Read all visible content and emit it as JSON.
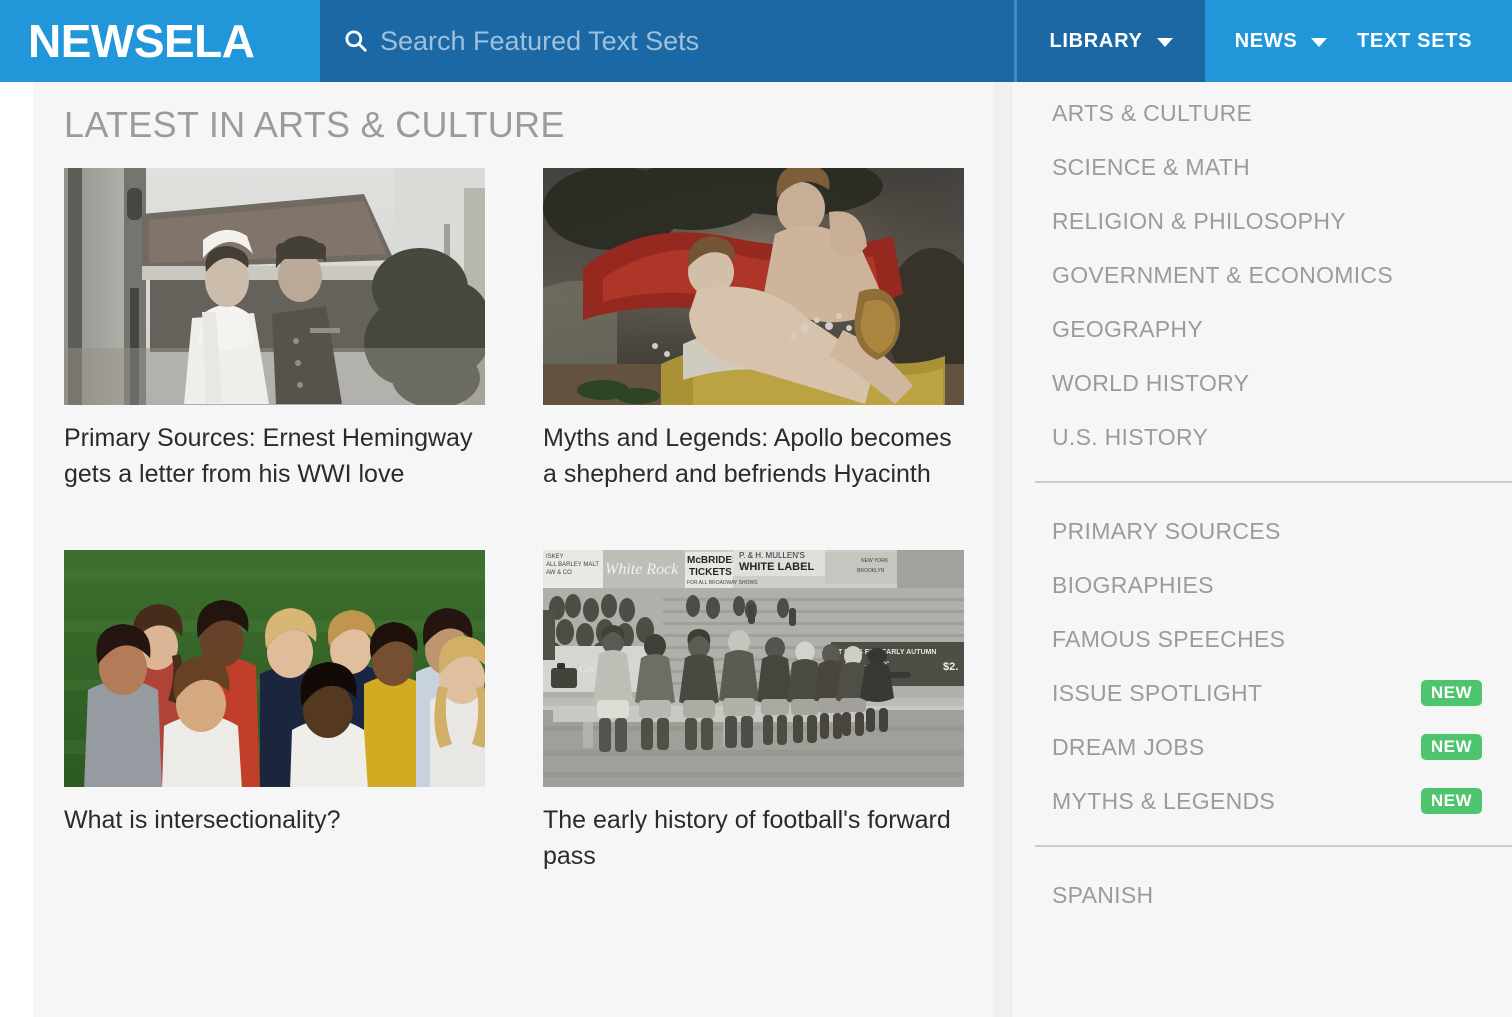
{
  "header": {
    "logo": "NEWSELA",
    "search": {
      "icon": "search-icon",
      "placeholder": "Search Featured Text Sets",
      "value": ""
    },
    "nav": [
      {
        "label": "LIBRARY",
        "has_caret": true,
        "active": true,
        "icon": "chevron-down-icon"
      },
      {
        "label": "NEWS",
        "has_caret": true,
        "active": false,
        "icon": "chevron-down-icon"
      },
      {
        "label": "TEXT SETS",
        "has_caret": false,
        "active": false,
        "icon": ""
      }
    ]
  },
  "main": {
    "section_title": "LATEST IN ARTS & CULTURE",
    "cards": [
      {
        "title": "Primary Sources: Ernest Hemingway gets a letter from his WWI love",
        "image": "vintage-photo-nurse-and-soldier"
      },
      {
        "title": "Myths and Legends: Apollo becomes a shepherd and befriends Hyacinth",
        "image": "painting-apollo-and-hyacinth"
      },
      {
        "title": "What is intersectionality?",
        "image": "photo-group-of-children-on-grass"
      },
      {
        "title": "The early history of football's forward pass",
        "image": "vintage-photo-football-team-on-bench"
      }
    ]
  },
  "sidebar": {
    "groups": [
      {
        "items": [
          {
            "label": "ARTS & CULTURE",
            "badge": ""
          },
          {
            "label": "SCIENCE & MATH",
            "badge": ""
          },
          {
            "label": "RELIGION & PHILOSOPHY",
            "badge": ""
          },
          {
            "label": "GOVERNMENT & ECONOMICS",
            "badge": ""
          },
          {
            "label": "GEOGRAPHY",
            "badge": ""
          },
          {
            "label": "WORLD HISTORY",
            "badge": ""
          },
          {
            "label": "U.S. HISTORY",
            "badge": ""
          }
        ]
      },
      {
        "items": [
          {
            "label": "PRIMARY SOURCES",
            "badge": ""
          },
          {
            "label": "BIOGRAPHIES",
            "badge": ""
          },
          {
            "label": "FAMOUS SPEECHES",
            "badge": ""
          },
          {
            "label": "ISSUE SPOTLIGHT",
            "badge": "NEW"
          },
          {
            "label": "DREAM JOBS",
            "badge": "NEW"
          },
          {
            "label": "MYTHS & LEGENDS",
            "badge": "NEW"
          }
        ]
      },
      {
        "items": [
          {
            "label": "SPANISH",
            "badge": ""
          }
        ]
      }
    ]
  },
  "colors": {
    "brand_blue": "#2196d9",
    "brand_blue_dark": "#1b68a4",
    "badge_green": "#4ec46e",
    "muted_text": "#9b9b9b",
    "content_bg": "#f6f6f6"
  }
}
